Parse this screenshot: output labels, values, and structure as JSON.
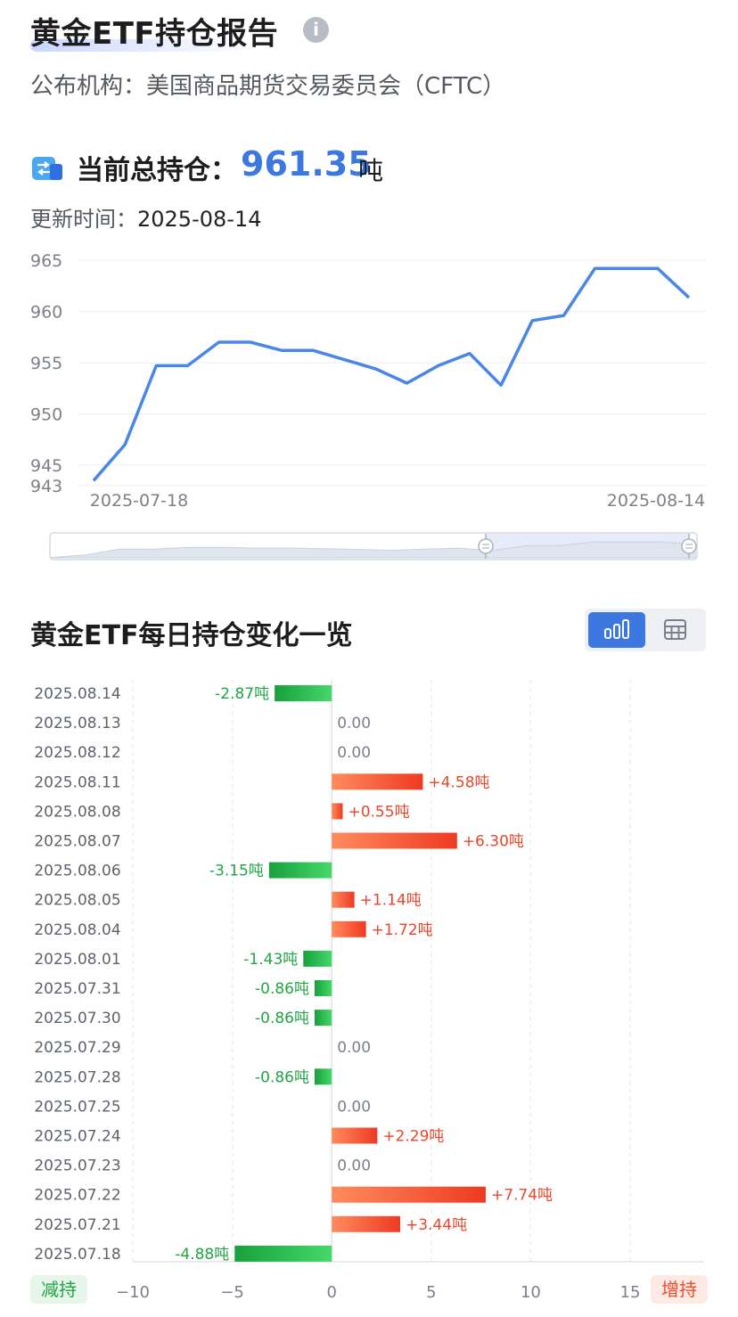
{
  "header": {
    "title": "黄金ETF持仓报告",
    "publisher": "公布机构：美国商品期货交易委员会（CFTC）"
  },
  "holding": {
    "label": "当前总持仓：",
    "value": "961.35",
    "unit": "吨",
    "update_label": "更新时间：",
    "update_date": "2025-08-14"
  },
  "section2": {
    "title": "黄金ETF每日持仓变化一览"
  },
  "colors": {
    "accent": "#3c78e0",
    "increase": "#f04a2a",
    "decrease": "#22a545"
  },
  "icons": {
    "info": "info-icon",
    "holding": "exchange-icon",
    "bar_view": "bar-chart-icon",
    "table_view": "table-icon"
  },
  "chart_data": [
    {
      "type": "line",
      "x": [
        "2025-07-18",
        "2025-07-21",
        "2025-07-22",
        "2025-07-23",
        "2025-07-24",
        "2025-07-25",
        "2025-07-28",
        "2025-07-29",
        "2025-07-30",
        "2025-07-31",
        "2025-08-01",
        "2025-08-04",
        "2025-08-05",
        "2025-08-06",
        "2025-08-07",
        "2025-08-08",
        "2025-08-11",
        "2025-08-12",
        "2025-08-13",
        "2025-08-14"
      ],
      "values": [
        943.5,
        947.0,
        954.7,
        954.7,
        957.0,
        957.0,
        956.2,
        956.2,
        955.3,
        954.4,
        953.0,
        954.7,
        955.9,
        952.8,
        959.1,
        959.6,
        964.2,
        964.2,
        964.2,
        961.35
      ],
      "yticks": [
        943,
        945,
        950,
        955,
        960,
        965
      ],
      "ylim": [
        943,
        965
      ],
      "xtick_labels": [
        "2025-07-18",
        "2025-08-14"
      ],
      "grid": true
    },
    {
      "type": "bar",
      "orientation": "horizontal",
      "categories": [
        "2025.08.14",
        "2025.08.13",
        "2025.08.12",
        "2025.08.11",
        "2025.08.08",
        "2025.08.07",
        "2025.08.06",
        "2025.08.05",
        "2025.08.04",
        "2025.08.01",
        "2025.07.31",
        "2025.07.30",
        "2025.07.29",
        "2025.07.28",
        "2025.07.25",
        "2025.07.24",
        "2025.07.23",
        "2025.07.22",
        "2025.07.21",
        "2025.07.18"
      ],
      "values": [
        -2.87,
        0,
        0,
        4.58,
        0.55,
        6.3,
        -3.15,
        1.14,
        1.72,
        -1.43,
        -0.86,
        -0.86,
        0,
        -0.86,
        0,
        2.29,
        0,
        7.74,
        3.44,
        -4.88
      ],
      "labels": [
        "-2.87吨",
        "0.00",
        "0.00",
        "+4.58吨",
        "+0.55吨",
        "+6.30吨",
        "-3.15吨",
        "+1.14吨",
        "+1.72吨",
        "-1.43吨",
        "-0.86吨",
        "-0.86吨",
        "0.00",
        "-0.86吨",
        "0.00",
        "+2.29吨",
        "0.00",
        "+7.74吨",
        "+3.44吨",
        "-4.88吨"
      ],
      "xticks": [
        -10,
        -5,
        0,
        5,
        10,
        15
      ],
      "xtick_labels": [
        "−10",
        "−5",
        "0",
        "5",
        "10",
        "15"
      ],
      "xlim": [
        -10,
        15
      ],
      "legend_left": "减持",
      "legend_right": "增持"
    }
  ]
}
